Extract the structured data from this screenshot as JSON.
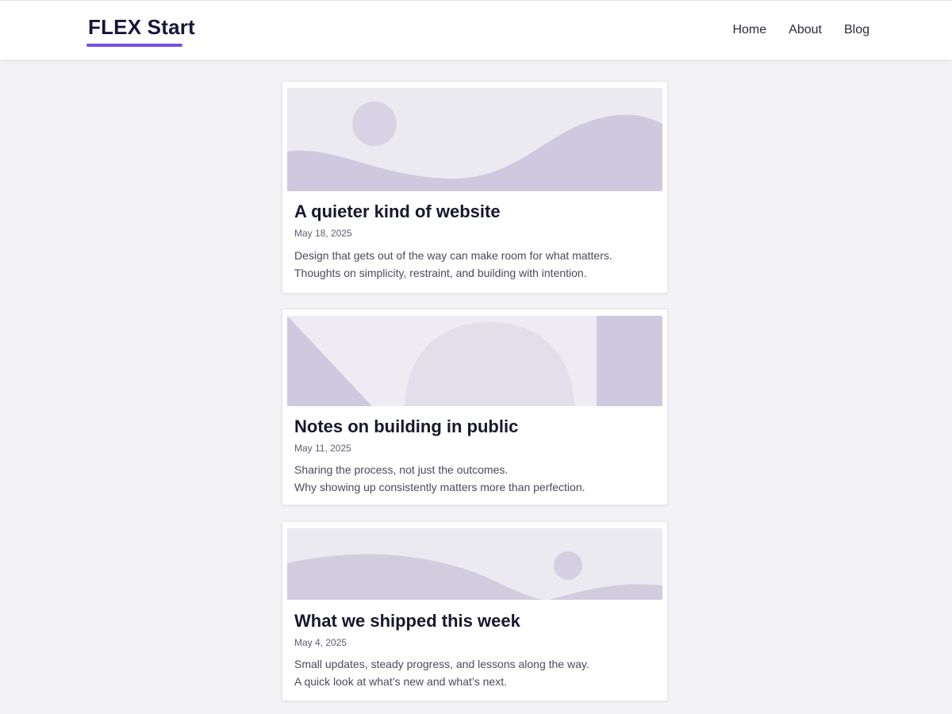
{
  "header": {
    "brand": "FLEX Start",
    "nav": [
      {
        "label": "Home"
      },
      {
        "label": "About"
      },
      {
        "label": "Blog"
      }
    ]
  },
  "posts": [
    {
      "title": "A quieter kind of website",
      "date": "May 18, 2025",
      "excerpt_line1": "Design that gets out of the way can make room for what matters.",
      "excerpt_line2": "Thoughts on simplicity, restraint, and building with intention."
    },
    {
      "title": "Notes on building in public",
      "date": "May 11, 2025",
      "excerpt_line1": "Sharing the process, not just the outcomes.",
      "excerpt_line2": "Why showing up consistently matters more than perfection."
    },
    {
      "title": "What we shipped this week",
      "date": "May 4, 2025",
      "excerpt_line1": "Small updates, steady progress, and lessons along the way.",
      "excerpt_line2": "A quick look at what’s new and what’s next."
    }
  ],
  "colors": {
    "accent": "#7b4fe0",
    "illustration_dark": "#cfc9df",
    "illustration_light": "#eceaf1"
  }
}
